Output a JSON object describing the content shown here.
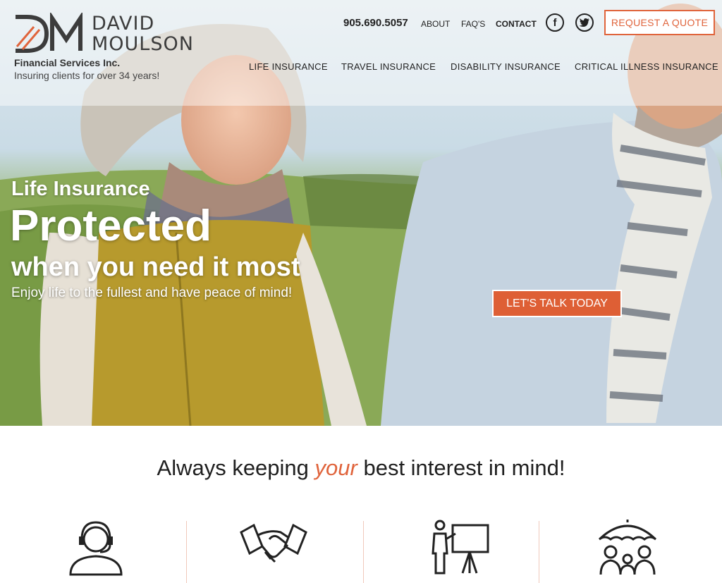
{
  "brand": {
    "name_line1": "DAVID",
    "name_line2": "MOULSON",
    "company": "Financial Services Inc.",
    "tagline": "Insuring clients for over 34 years!"
  },
  "header": {
    "phone": "905.690.5057",
    "about": "ABOUT",
    "faq": "FAQ'S",
    "contact": "CONTACT",
    "facebook_glyph": "f",
    "quote_button": "REQUEST A QUOTE"
  },
  "nav": {
    "items": [
      {
        "label": "LIFE INSURANCE"
      },
      {
        "label": "TRAVEL INSURANCE"
      },
      {
        "label": "DISABILITY INSURANCE"
      },
      {
        "label": "CRITICAL ILLNESS INSURANCE"
      }
    ]
  },
  "hero": {
    "subtitle": "Life Insurance",
    "title": "Protected",
    "title2": "when you need it most",
    "description": "Enjoy life to the fullest and have peace of mind!",
    "cta": "LET'S TALK TODAY"
  },
  "section": {
    "headline_before": "Always keeping ",
    "headline_emphasis": "your",
    "headline_after": " best interest in mind!"
  },
  "icons": [
    "headset-agent-icon",
    "handshake-icon",
    "presenter-board-icon",
    "umbrella-family-icon"
  ],
  "colors": {
    "accent": "#e0643c",
    "cta_bg": "#de5f35"
  }
}
